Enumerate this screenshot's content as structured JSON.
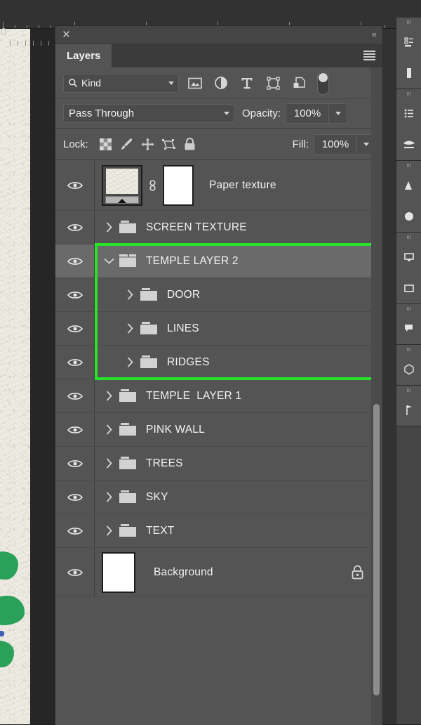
{
  "workspace": {
    "ruler_origin_label": "0"
  },
  "panel": {
    "close_icon": "close-icon",
    "collapse_label": "«",
    "tab_label": "Layers",
    "menu_icon": "hamburger-menu-icon"
  },
  "filter": {
    "kind_label": "Kind",
    "icons": [
      "pixel-layer-filter-icon",
      "adjustment-layer-filter-icon",
      "type-layer-filter-icon",
      "shape-layer-filter-icon",
      "smart-object-filter-icon"
    ],
    "toggle_name": "filter-enable-toggle"
  },
  "blend": {
    "mode": "Pass Through",
    "opacity_label": "Opacity:",
    "opacity_value": "100%"
  },
  "lock": {
    "label": "Lock:",
    "icons": [
      "lock-transparent-pixels-icon",
      "lock-image-pixels-icon",
      "lock-position-icon",
      "lock-artboard-nesting-icon",
      "lock-all-icon"
    ],
    "fill_label": "Fill:",
    "fill_value": "100%"
  },
  "layers": [
    {
      "name": "Paper texture",
      "type": "smart-object-with-mask",
      "visible": true,
      "indent": 0,
      "selected": false,
      "expanded": null,
      "locked": false
    },
    {
      "name": "SCREEN TEXTURE",
      "type": "group",
      "visible": true,
      "indent": 0,
      "selected": false,
      "expanded": false,
      "locked": false
    },
    {
      "name": "TEMPLE LAYER 2",
      "type": "group",
      "visible": true,
      "indent": 0,
      "selected": true,
      "expanded": true,
      "locked": false
    },
    {
      "name": "DOOR",
      "type": "group",
      "visible": true,
      "indent": 1,
      "selected": false,
      "expanded": false,
      "locked": false
    },
    {
      "name": "LINES",
      "type": "group",
      "visible": true,
      "indent": 1,
      "selected": false,
      "expanded": false,
      "locked": false
    },
    {
      "name": "RIDGES",
      "type": "group",
      "visible": true,
      "indent": 1,
      "selected": false,
      "expanded": false,
      "locked": false
    },
    {
      "name": "TEMPLE  LAYER 1",
      "type": "group",
      "visible": true,
      "indent": 0,
      "selected": false,
      "expanded": false,
      "locked": false
    },
    {
      "name": "PINK WALL",
      "type": "group",
      "visible": true,
      "indent": 0,
      "selected": false,
      "expanded": false,
      "locked": false
    },
    {
      "name": "TREES",
      "type": "group",
      "visible": true,
      "indent": 0,
      "selected": false,
      "expanded": false,
      "locked": false
    },
    {
      "name": "SKY",
      "type": "group",
      "visible": true,
      "indent": 0,
      "selected": false,
      "expanded": false,
      "locked": false
    },
    {
      "name": "TEXT",
      "type": "group",
      "visible": true,
      "indent": 0,
      "selected": false,
      "expanded": false,
      "locked": false
    },
    {
      "name": "Background",
      "type": "pixel",
      "visible": true,
      "indent": 0,
      "selected": false,
      "expanded": null,
      "locked": true
    }
  ],
  "annotation": {
    "highlight_color": "#27e32a",
    "highlight_target": "TEMPLE LAYER 2 group and its children"
  },
  "colors": {
    "panel_bg": "#545454",
    "row_selected_bg": "#6a6a6a",
    "titlebar_bg": "#454545",
    "tabstrip_bg": "#3b3b3b",
    "text": "#f2f2f2",
    "highlight_green": "#27e32a",
    "canvas_paper": "#eeece3",
    "leaf_green": "#2aa058"
  }
}
